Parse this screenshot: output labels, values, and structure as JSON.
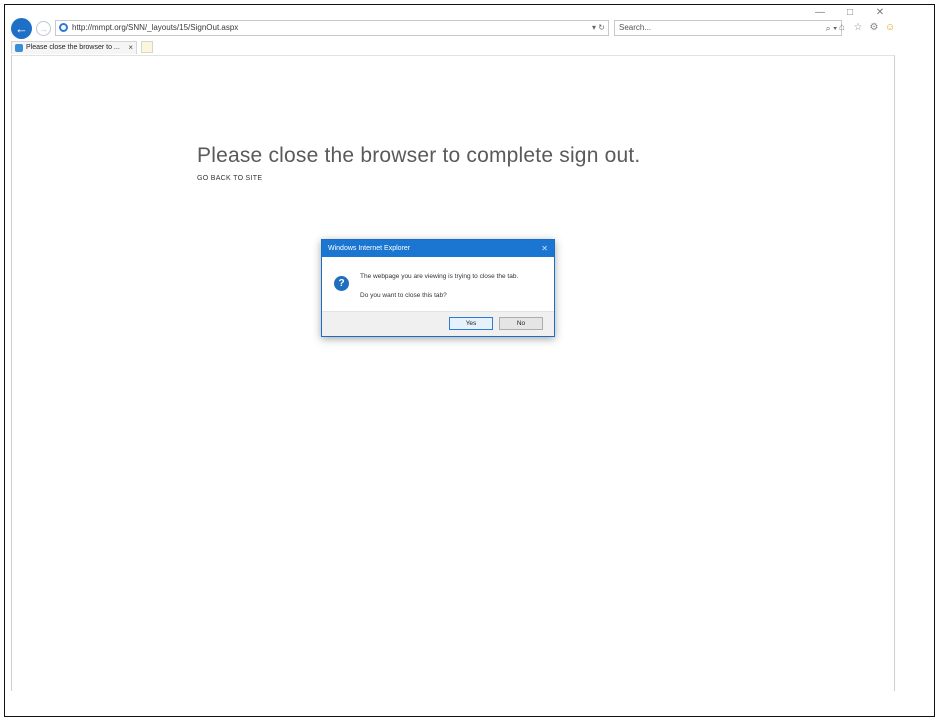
{
  "window": {
    "minimize_glyph": "—",
    "maximize_glyph": "□",
    "close_glyph": "✕"
  },
  "navbar": {
    "back_glyph": "←",
    "forward_glyph": "→",
    "address": "http://mmpt.org/SNN/_layouts/15/SignOut.aspx",
    "refresh_glyph": "▾ ↻",
    "search_placeholder": "Search...",
    "search_glyph": "⌕ ▾",
    "tools": [
      "⌂",
      "☆",
      "⚙",
      "☺"
    ]
  },
  "tabs": [
    {
      "label": "Please close the browser to ...",
      "close_glyph": "×"
    }
  ],
  "page": {
    "heading": "Please close the browser to complete sign out.",
    "go_back_link": "GO BACK TO SITE"
  },
  "dialog": {
    "title": "Windows Internet Explorer",
    "close_glyph": "✕",
    "icon_glyph": "?",
    "message_line1": "The webpage you are viewing is trying to close the tab.",
    "message_line2": "Do you want to close this tab?",
    "yes_label": "Yes",
    "no_label": "No"
  },
  "colors": {
    "accent": "#1b76d1",
    "heading_text": "#5a5a5a"
  }
}
